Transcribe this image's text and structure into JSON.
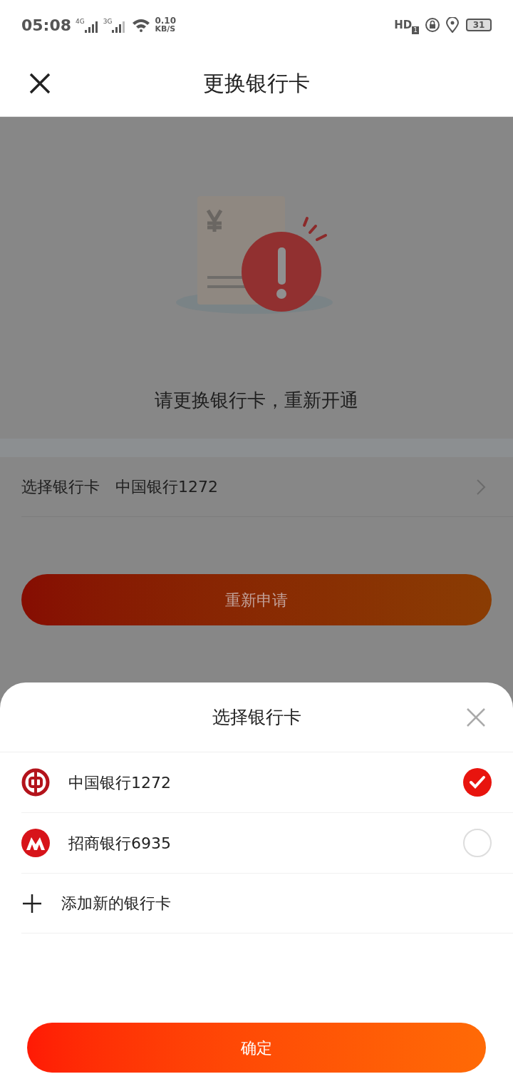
{
  "status_bar": {
    "time": "05:08",
    "network_1": "4G",
    "network_2": "3G",
    "speed_value": "0.10",
    "speed_unit": "KB/S",
    "hd": "HD",
    "sim": "1",
    "battery": "31"
  },
  "header": {
    "title": "更换银行卡"
  },
  "notice": {
    "message": "请更换银行卡，重新开通"
  },
  "card_row": {
    "label": "选择银行卡",
    "value": "中国银行1272"
  },
  "reapply_button": "重新申请",
  "sheet": {
    "title": "选择银行卡",
    "cards": [
      {
        "name": "中国银行1272",
        "kind": "boc",
        "selected": true
      },
      {
        "name": "招商银行6935",
        "kind": "cmb",
        "selected": false
      }
    ],
    "add_label": "添加新的银行卡",
    "confirm_button": "确定"
  }
}
